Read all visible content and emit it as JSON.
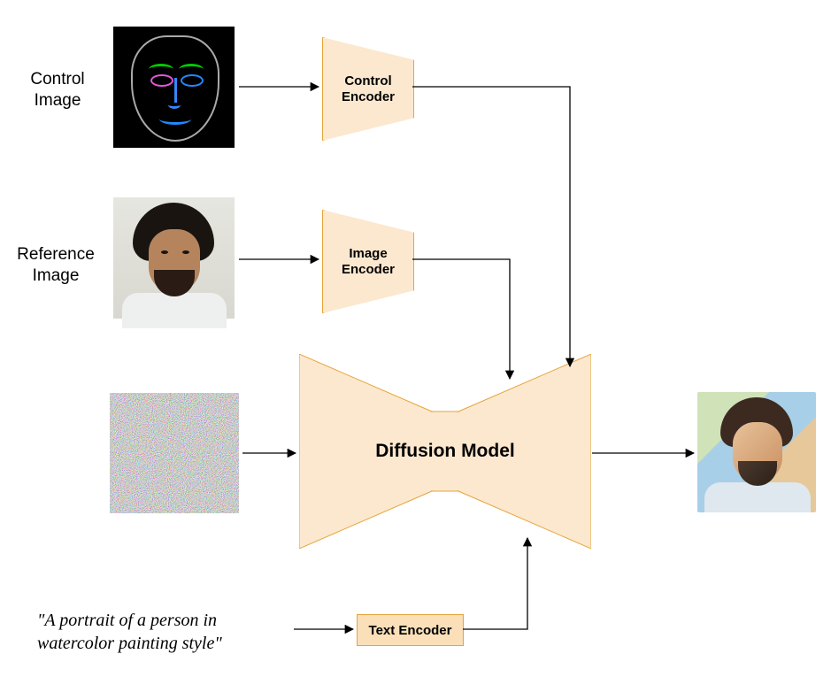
{
  "labels": {
    "control_image": "Control\nImage",
    "reference_image": "Reference\nImage"
  },
  "blocks": {
    "control_encoder": "Control\nEncoder",
    "image_encoder": "Image\nEncoder",
    "diffusion_model": "Diffusion Model",
    "text_encoder": "Text Encoder"
  },
  "prompt": "\"A portrait of a person in\nwatercolor painting style\"",
  "colors": {
    "block_fill": "#fce8cf",
    "block_stroke": "#e5a53a",
    "text_encoder_fill": "#fadfb9"
  }
}
